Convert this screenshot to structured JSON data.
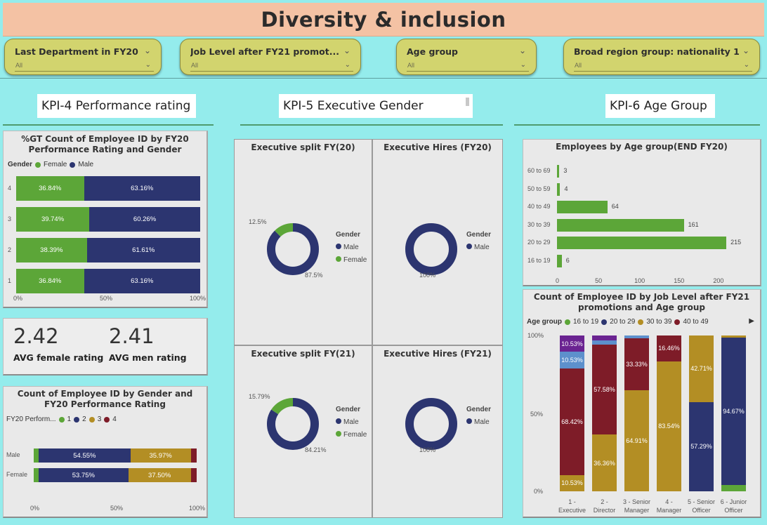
{
  "title": "Diversity & inclusion",
  "slicers": [
    {
      "title": "Last Department in FY20",
      "value": "All"
    },
    {
      "title": "Job Level after FY21 promot...",
      "value": "All"
    },
    {
      "title": "Age group",
      "value": "All"
    },
    {
      "title": "Broad region group: nationality 1",
      "value": "All"
    }
  ],
  "kpi": {
    "perf": "KPI-4 Performance rating",
    "gender": "KPI-5 Executive Gender",
    "age": "KPI-6 Age Group"
  },
  "colors": {
    "female": "#5ca638",
    "male": "#2c3570",
    "r3": "#b38e24",
    "r4": "#7e1c28",
    "age_1619": "#5ca638",
    "age_2029": "#2c3570",
    "age_3039": "#b38e24",
    "age_4049": "#7e1c28",
    "purple": "#6a2391",
    "lightblue": "#5d90cc"
  },
  "perf_rating_chart": {
    "title": "%GT Count of Employee ID by FY20 Performance Rating and Gender",
    "legend_title": "Gender",
    "legend": [
      "Female",
      "Male"
    ],
    "x_ticks": [
      "0%",
      "50%",
      "100%"
    ],
    "chart_data": {
      "type": "bar",
      "categories": [
        "4",
        "3",
        "2",
        "1"
      ],
      "series": [
        {
          "name": "Female",
          "values": [
            36.84,
            39.74,
            38.39,
            36.84
          ],
          "labels": [
            "36.84%",
            "39.74%",
            "38.39%",
            "36.84%"
          ]
        },
        {
          "name": "Male",
          "values": [
            63.16,
            60.26,
            61.61,
            63.16
          ],
          "labels": [
            "63.16%",
            "60.26%",
            "61.61%",
            "63.16%"
          ]
        }
      ]
    }
  },
  "avg": {
    "female_value": "2.42",
    "female_label": "AVG female rating",
    "men_value": "2.41",
    "men_label": "AVG men rating"
  },
  "gender_rating_chart": {
    "title": "Count of Employee ID by Gender and FY20 Performance Rating",
    "legend_title": "FY20 Perform...",
    "legend": [
      "1",
      "2",
      "3",
      "4"
    ],
    "x_ticks": [
      "0%",
      "50%",
      "100%"
    ],
    "chart_data": {
      "type": "bar",
      "categories": [
        "Male",
        "Female"
      ],
      "series": [
        {
          "name": "1",
          "values": [
            3.0,
            3.0
          ]
        },
        {
          "name": "2",
          "values": [
            54.55,
            53.75
          ],
          "labels": [
            "54.55%",
            "53.75%"
          ]
        },
        {
          "name": "3",
          "values": [
            35.97,
            37.5
          ],
          "labels": [
            "35.97%",
            "37.50%"
          ]
        },
        {
          "name": "4",
          "values": [
            3.5,
            3.5
          ]
        }
      ]
    }
  },
  "exec": {
    "split20": {
      "title": "Executive split FY(20)",
      "female_label": "12.5%",
      "male_label": "87.5%",
      "legend_title": "Gender",
      "legend": [
        "Male",
        "Female"
      ],
      "chart_data": {
        "type": "pie",
        "labels": [
          "Male",
          "Female"
        ],
        "values": [
          87.5,
          12.5
        ]
      }
    },
    "hires20": {
      "title": "Executive Hires (FY20)",
      "male_label": "100%",
      "legend_title": "Gender",
      "legend": [
        "Male"
      ],
      "chart_data": {
        "type": "pie",
        "labels": [
          "Male"
        ],
        "values": [
          100
        ]
      }
    },
    "split21": {
      "title": "Executive split FY(21)",
      "female_label": "15.79%",
      "male_label": "84.21%",
      "legend_title": "Gender",
      "legend": [
        "Male",
        "Female"
      ],
      "chart_data": {
        "type": "pie",
        "labels": [
          "Male",
          "Female"
        ],
        "values": [
          84.21,
          15.79
        ]
      }
    },
    "hires21": {
      "title": "Executive Hires (FY21)",
      "male_label": "100%",
      "legend_title": "Gender",
      "legend": [
        "Male"
      ],
      "chart_data": {
        "type": "pie",
        "labels": [
          "Male"
        ],
        "values": [
          100
        ]
      }
    }
  },
  "age_chart": {
    "title": "Employees by Age group(END FY20)",
    "x_ticks": [
      "0",
      "50",
      "100",
      "150",
      "200"
    ],
    "chart_data": {
      "type": "bar",
      "categories": [
        "60 to 69",
        "50 to 59",
        "40 to 49",
        "30 to 39",
        "20 to 29",
        "16 to 19"
      ],
      "values": [
        3,
        4,
        64,
        161,
        215,
        6
      ],
      "xlim": [
        0,
        230
      ]
    }
  },
  "job_age_chart": {
    "title": "Count of Employee ID by Job Level after FY21 promotions and Age group",
    "legend_title": "Age group",
    "legend": [
      "16 to 19",
      "20 to 29",
      "30 to 39",
      "40 to 49"
    ],
    "y_ticks": [
      "100%",
      "50%",
      "0%"
    ],
    "chart_data": {
      "type": "bar",
      "categories": [
        "1 - Executive",
        "2 - Director",
        "3 - Senior Manager",
        "4 - Manager",
        "5 - Senior Officer",
        "6 - Junior Officer"
      ],
      "cat_lines": [
        [
          "1 -",
          "Executive"
        ],
        [
          "2 -",
          "Director"
        ],
        [
          "3 - Senior",
          "Manager"
        ],
        [
          "4 -",
          "Manager"
        ],
        [
          "5 - Senior",
          "Officer"
        ],
        [
          "6 - Junior",
          "Officer"
        ]
      ],
      "stacks": [
        [
          {
            "c": "r3",
            "v": 10.53,
            "l": "10.53%"
          },
          {
            "c": "r4",
            "v": 68.42,
            "l": "68.42%"
          },
          {
            "c": "lightblue",
            "v": 10.53,
            "l": "10.53%"
          },
          {
            "c": "purple",
            "v": 10.53,
            "l": "10.53%"
          }
        ],
        [
          {
            "c": "r3",
            "v": 36.36,
            "l": "36.36%"
          },
          {
            "c": "r4",
            "v": 57.58,
            "l": "57.58%"
          },
          {
            "c": "lightblue",
            "v": 3.03,
            "l": ""
          },
          {
            "c": "purple",
            "v": 3.03,
            "l": ""
          }
        ],
        [
          {
            "c": "r3",
            "v": 64.91,
            "l": "64.91%"
          },
          {
            "c": "r4",
            "v": 33.33,
            "l": "33.33%"
          },
          {
            "c": "lightblue",
            "v": 1.76,
            "l": ""
          }
        ],
        [
          {
            "c": "r3",
            "v": 83.54,
            "l": "83.54%"
          },
          {
            "c": "r4",
            "v": 16.46,
            "l": "16.46%"
          }
        ],
        [
          {
            "c": "male",
            "v": 57.29,
            "l": "57.29%"
          },
          {
            "c": "r3",
            "v": 42.71,
            "l": "42.71%"
          }
        ],
        [
          {
            "c": "female",
            "v": 4.0,
            "l": ""
          },
          {
            "c": "male",
            "v": 94.67,
            "l": "94.67%"
          },
          {
            "c": "r3",
            "v": 1.33,
            "l": ""
          }
        ]
      ]
    }
  }
}
